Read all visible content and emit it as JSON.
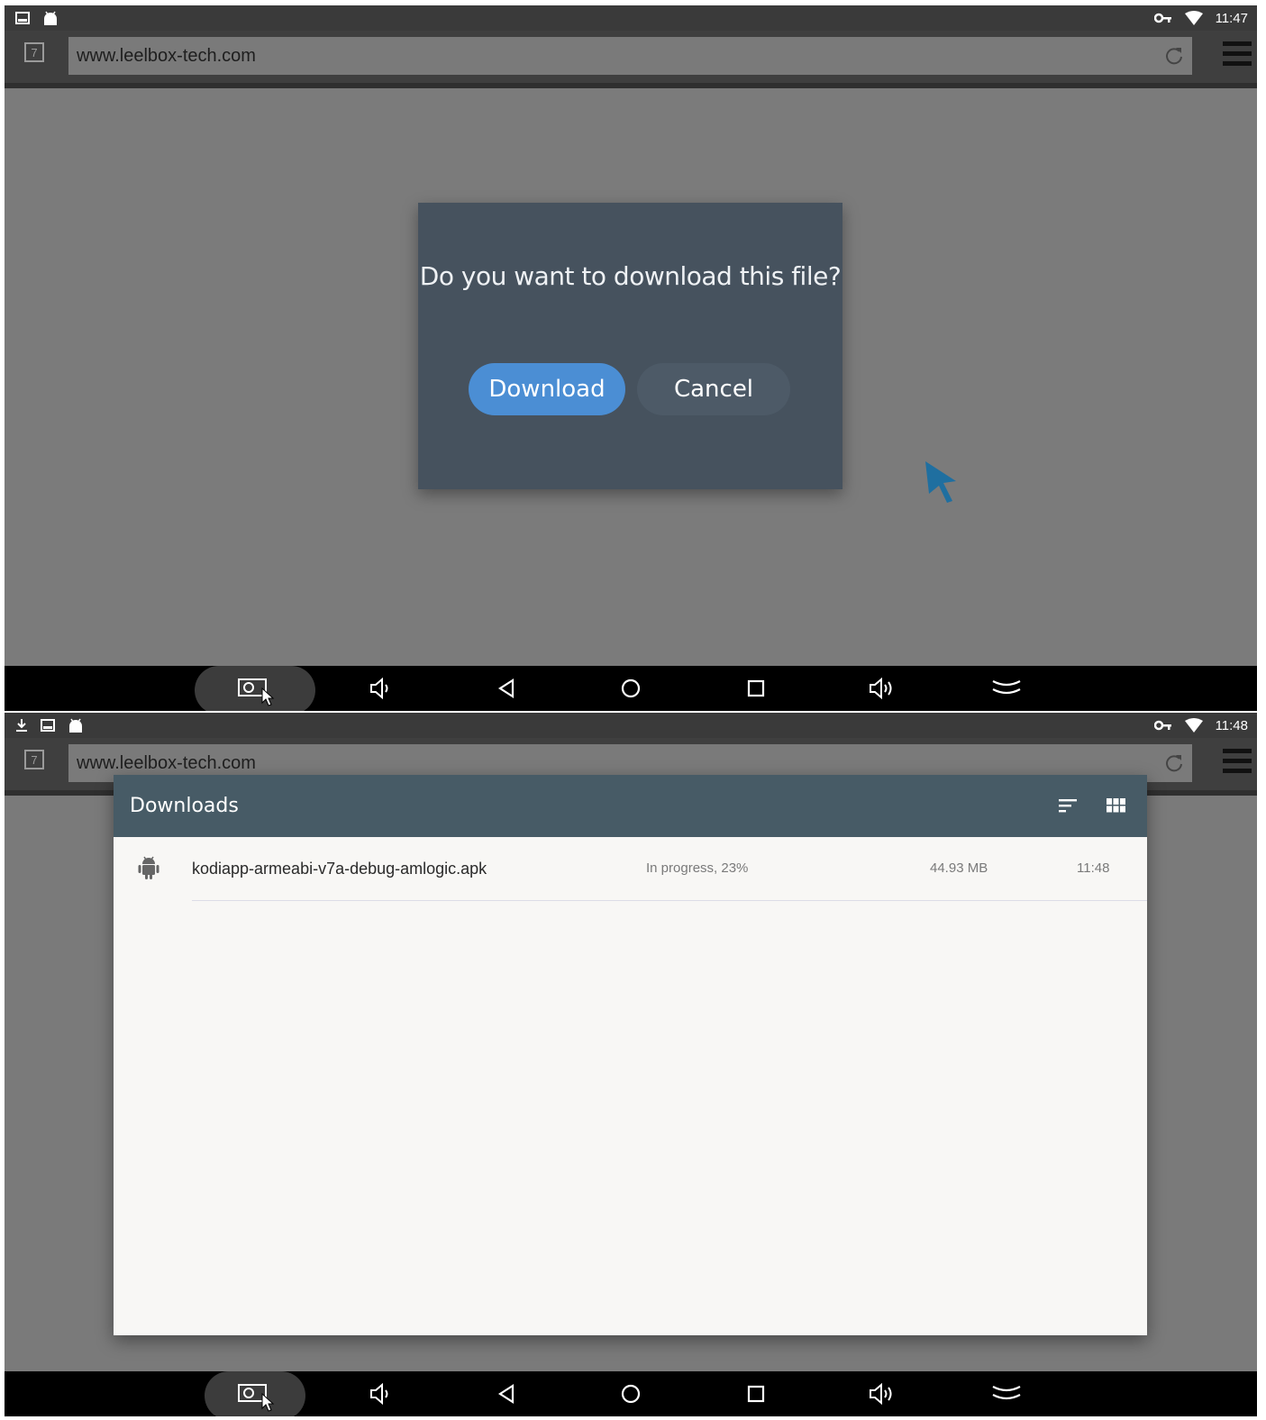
{
  "screen1": {
    "status": {
      "time": "11:47"
    },
    "browser": {
      "tab_count": "7",
      "url": "www.leelbox-tech.com"
    },
    "dialog": {
      "message": "Do you want to download this file?",
      "download_label": "Download",
      "cancel_label": "Cancel"
    }
  },
  "screen2": {
    "status": {
      "time": "11:48"
    },
    "browser": {
      "tab_count": "7",
      "url": "www.leelbox-tech.com"
    },
    "downloads": {
      "title": "Downloads",
      "items": [
        {
          "filename": "kodiapp-armeabi-v7a-debug-amlogic.apk",
          "status": "In progress, 23%",
          "progress_percent": 23,
          "size": "44.93 MB",
          "time": "11:48"
        }
      ]
    }
  },
  "colors": {
    "dialog_bg": "#46525e",
    "download_button": "#4b8ed4",
    "downloads_header": "#475b66",
    "cursor": "#1f6fa0"
  },
  "icons": {
    "status_left_1": "image-notification-icon",
    "status_left_2": "android-notification-icon",
    "status_right": [
      "vpn-key-icon",
      "wifi-icon"
    ],
    "nav": [
      "screenshot-icon",
      "volume-down-icon",
      "back-icon",
      "home-icon",
      "recents-icon",
      "volume-up-icon",
      "collapse-icon"
    ]
  }
}
